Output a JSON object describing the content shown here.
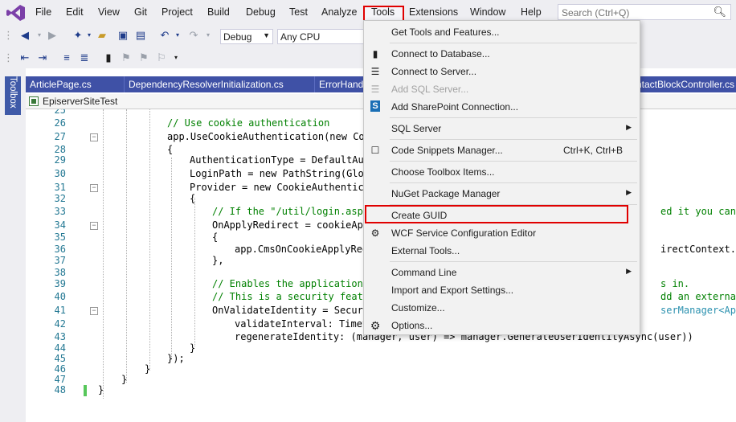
{
  "menubar": {
    "items": [
      "File",
      "Edit",
      "View",
      "Git",
      "Project",
      "Build",
      "Debug",
      "Test",
      "Analyze",
      "Tools",
      "Extensions",
      "Window",
      "Help"
    ],
    "search_placeholder": "Search (Ctrl+Q)"
  },
  "toolbar": {
    "config": "Debug",
    "platform": "Any CPU"
  },
  "toolbox_label": "Toolbox",
  "tabs": [
    "ArticlePage.cs",
    "DependencyResolverInitialization.cs",
    "ErrorHand",
    "ntactBlockController.cs"
  ],
  "nav_project": "EpiserverSiteTest",
  "code_lines": [
    {
      "n": "25",
      "t": ""
    },
    {
      "n": "26",
      "t": "// Use cookie authentication"
    },
    {
      "n": "27",
      "t": "app.UseCookieAuthentication(new Coo"
    },
    {
      "n": "28",
      "t": "{"
    },
    {
      "n": "29",
      "t": "AuthenticationType = DefaultAut"
    },
    {
      "n": "30",
      "t": "LoginPath = new PathString(Glob"
    },
    {
      "n": "31",
      "t": "Provider = new CookieAuthentica"
    },
    {
      "n": "32",
      "t": "{"
    },
    {
      "n": "33",
      "t": "// If the \"/util/login.asp"
    },
    {
      "n": "34",
      "t": "OnApplyRedirect = cookieApp"
    },
    {
      "n": "35",
      "t": "{"
    },
    {
      "n": "36",
      "t": "app.CmsOnCookieApplyRed"
    },
    {
      "n": "37",
      "t": "},"
    },
    {
      "n": "38",
      "t": ""
    },
    {
      "n": "39",
      "t": "// Enables the application"
    },
    {
      "n": "40",
      "t": "// This is a security featu"
    },
    {
      "n": "41",
      "t": "OnValidateIdentity = Securi"
    },
    {
      "n": "42",
      "t": "validateInterval: TimeS"
    },
    {
      "n": "43",
      "t": "regenerateIdentity: (manager, user) => manager.GenerateUserIdentityAsync(user))"
    },
    {
      "n": "44",
      "t": "}"
    },
    {
      "n": "45",
      "t": "});"
    },
    {
      "n": "46",
      "t": "}"
    },
    {
      "n": "47",
      "t": "}"
    },
    {
      "n": "48",
      "t": "}"
    }
  ],
  "code_right": {
    "l33": "ed it you can rem",
    "l36": "irectContext.Owin",
    "l39": "s in.",
    "l40": "dd an external lo",
    "l41": "serManager<Applic"
  },
  "tools_menu": {
    "get_tools": "Get Tools and Features...",
    "connect_db": "Connect to Database...",
    "connect_server": "Connect to Server...",
    "add_sql": "Add SQL Server...",
    "add_sharepoint": "Add SharePoint Connection...",
    "sql_server": "SQL Server",
    "snippets": "Code Snippets Manager...",
    "snippets_shortcut": "Ctrl+K, Ctrl+B",
    "toolbox_items": "Choose Toolbox Items...",
    "nuget": "NuGet Package Manager",
    "create_guid": "Create GUID",
    "wcf": "WCF Service Configuration Editor",
    "external": "External Tools...",
    "command_line": "Command Line",
    "import_export": "Import and Export Settings...",
    "customize": "Customize...",
    "options": "Options..."
  },
  "colors": {
    "accent_red": "#e00000",
    "tab_blue": "#3f51a6",
    "vs_purple": "#68217a"
  }
}
